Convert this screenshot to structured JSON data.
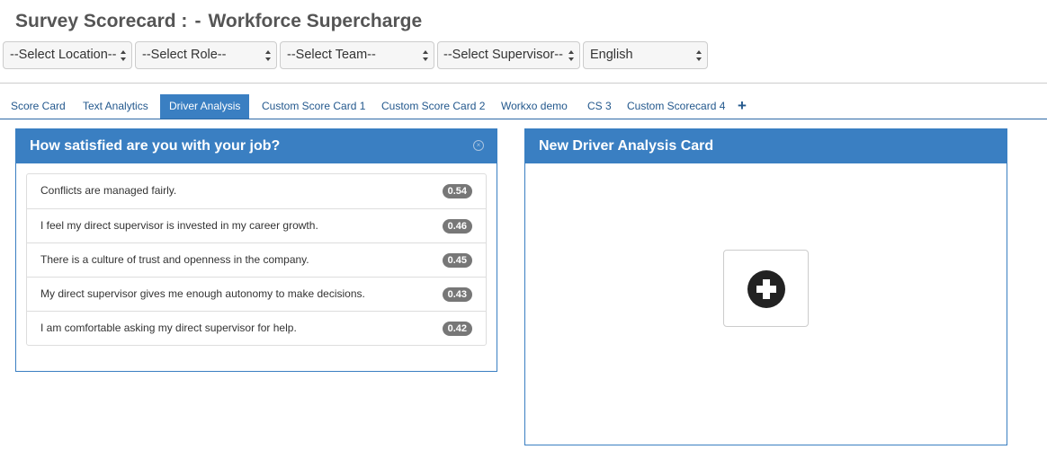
{
  "header": {
    "title": "Survey Scorecard :",
    "separator": "-",
    "subtitle": "Workforce Supercharge"
  },
  "filters": {
    "location": "--Select Location--",
    "role": "--Select Role--",
    "team": "--Select Team--",
    "supervisor": "--Select Supervisor--",
    "language": "English"
  },
  "tabs": [
    {
      "label": "Score Card",
      "active": false
    },
    {
      "label": "Text Analytics",
      "active": false
    },
    {
      "label": "Driver Analysis",
      "active": true
    },
    {
      "label": "Custom Score Card 1",
      "active": false
    },
    {
      "label": "Custom Score Card 2",
      "active": false
    },
    {
      "label": "Workxo demo",
      "active": false
    },
    {
      "label": "CS 3",
      "active": false
    },
    {
      "label": "Custom Scorecard 4",
      "active": false
    }
  ],
  "add_tab_glyph": "+",
  "question_card": {
    "title": "How satisfied are you with your job?",
    "close_glyph": "×",
    "drivers": [
      {
        "text": "Conflicts are managed fairly.",
        "score": "0.54"
      },
      {
        "text": "I feel my direct supervisor is invested in my career growth.",
        "score": "0.46"
      },
      {
        "text": "There is a culture of trust and openness in the company.",
        "score": "0.45"
      },
      {
        "text": "My direct supervisor gives me enough autonomy to make decisions.",
        "score": "0.43"
      },
      {
        "text": "I am comfortable asking my direct supervisor for help.",
        "score": "0.42"
      }
    ]
  },
  "new_card": {
    "title": "New Driver Analysis Card",
    "add_icon": "plus-circle-icon"
  },
  "colors": {
    "primary": "#3a7fc2",
    "tab_text": "#23588d",
    "badge": "#777777"
  }
}
